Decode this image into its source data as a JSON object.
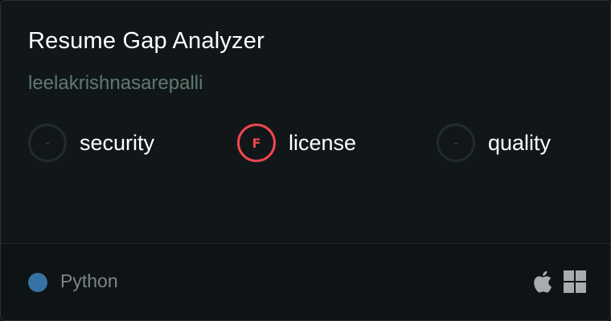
{
  "card": {
    "title": "Resume Gap Analyzer",
    "author": "leelakrishnasarepalli"
  },
  "scores": [
    {
      "grade": "-",
      "label": "security",
      "status": "none"
    },
    {
      "grade": "F",
      "label": "license",
      "status": "fail"
    },
    {
      "grade": "-",
      "label": "quality",
      "status": "none"
    }
  ],
  "footer": {
    "language": "Python",
    "language_color": "#3772a4",
    "platforms": [
      "apple-icon",
      "windows-icon"
    ]
  },
  "colors": {
    "background": "#111719",
    "fail": "#f0474d",
    "author": "#5e7a70"
  }
}
